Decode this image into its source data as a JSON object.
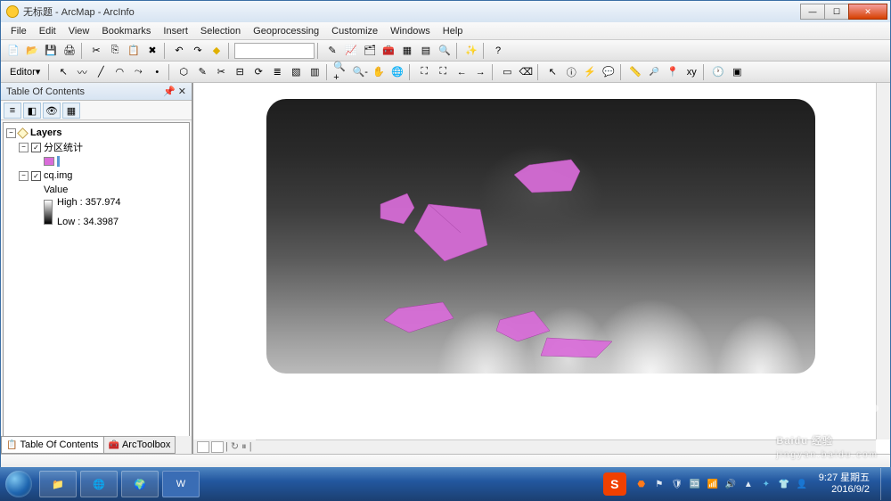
{
  "window": {
    "title": "无标题 - ArcMap - ArcInfo"
  },
  "menu": [
    "File",
    "Edit",
    "View",
    "Bookmarks",
    "Insert",
    "Selection",
    "Geoprocessing",
    "Customize",
    "Windows",
    "Help"
  ],
  "editor": {
    "label": "Editor"
  },
  "toc": {
    "title": "Table Of Contents",
    "layers_label": "Layers",
    "layer1": {
      "name": "分区统计"
    },
    "layer2": {
      "name": "cq.img",
      "value_label": "Value",
      "high": "High : 357.974",
      "low": "Low : 34.3987"
    },
    "tabs": {
      "contents": "Table Of Contents",
      "toolbox": "ArcToolbox"
    }
  },
  "colors": {
    "poly": "#d96cd9",
    "poly_outline": "#5b99d4"
  },
  "taskbar": {
    "time": "9:27",
    "day": "星期五",
    "date": "2016/9/2"
  },
  "watermark": {
    "brand": "Baidu 经验",
    "url": "jingyan.baidu.com"
  }
}
